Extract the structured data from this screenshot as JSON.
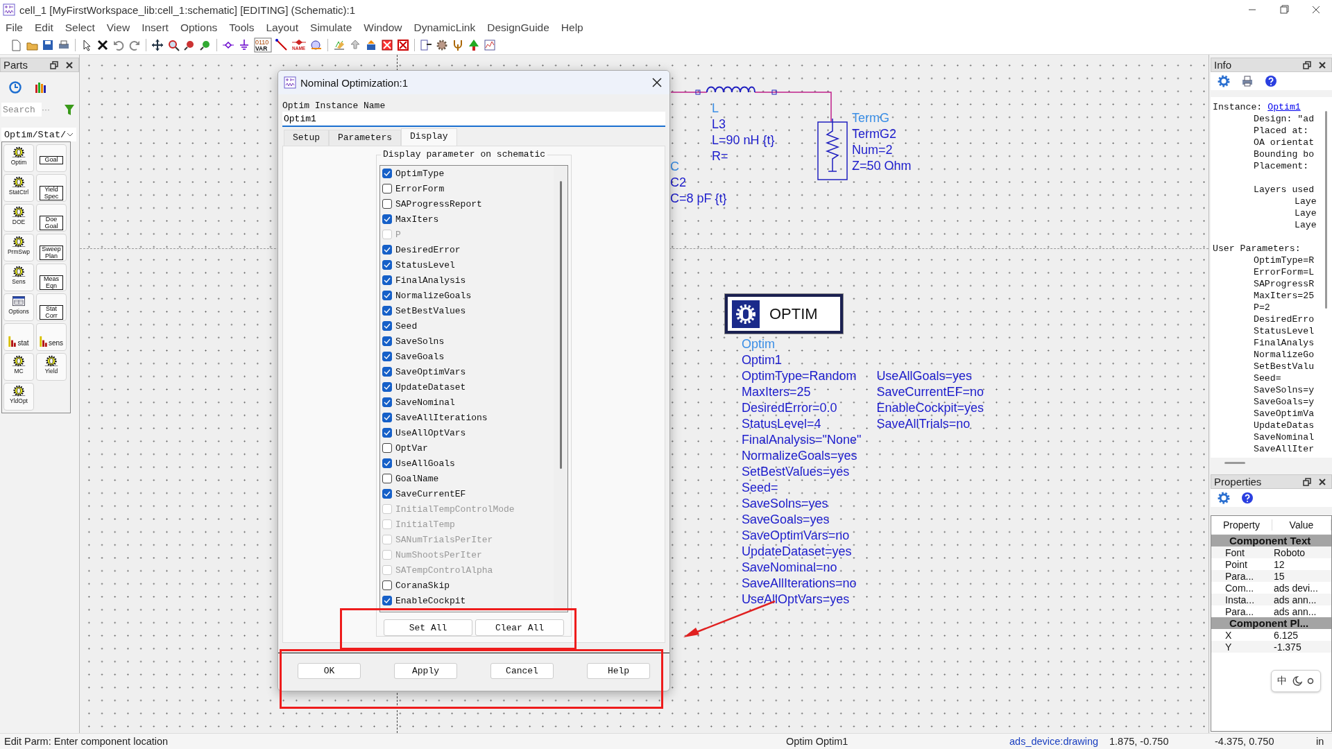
{
  "window": {
    "title": "cell_1 [MyFirstWorkspace_lib:cell_1:schematic] [EDITING] (Schematic):1"
  },
  "menu": [
    "File",
    "Edit",
    "Select",
    "View",
    "Insert",
    "Options",
    "Tools",
    "Layout",
    "Simulate",
    "Window",
    "DynamicLink",
    "DesignGuide",
    "Help"
  ],
  "toolbar": {
    "var_bits": "0110",
    "var_label": "VAR",
    "name_label": "NAME"
  },
  "parts_panel": {
    "title": "Parts",
    "search": {
      "placeholder": "Search",
      "more": "···"
    },
    "library": "Optim/Stat/",
    "items": [
      {
        "kind": "gear",
        "label": "Optim"
      },
      {
        "kind": "box",
        "label": "Goal"
      },
      {
        "kind": "gear",
        "label": "StatCtrl"
      },
      {
        "kind": "box",
        "label": "Yield Spec"
      },
      {
        "kind": "gear",
        "label": "DOE"
      },
      {
        "kind": "box",
        "label": "Doe Goal"
      },
      {
        "kind": "gear",
        "label": "PrmSwp"
      },
      {
        "kind": "box",
        "label": "Sweep Plan"
      },
      {
        "kind": "gear",
        "label": "Sens"
      },
      {
        "kind": "box",
        "label": "Meas Eqn"
      },
      {
        "kind": "window",
        "label": "Options"
      },
      {
        "kind": "box",
        "label": "Stat Corr"
      },
      {
        "kind": "chart",
        "label": "stat"
      },
      {
        "kind": "chart",
        "label": "sens"
      },
      {
        "kind": "gear",
        "label": "MC"
      },
      {
        "kind": "gear",
        "label": "Yield"
      },
      {
        "kind": "gear",
        "label": "YldOpt"
      }
    ]
  },
  "schematic": {
    "labels": [
      {
        "kind": "inductor",
        "lines": [
          "L",
          "L3",
          "L=90 nH {t}",
          "R="
        ]
      },
      {
        "kind": "capacitor",
        "lines": [
          "C",
          "C2",
          "C=8 pF {t}"
        ]
      },
      {
        "kind": "term",
        "lines": [
          "TermG",
          "TermG2",
          "Num=2",
          "Z=50 Ohm"
        ]
      }
    ],
    "optim_block": {
      "label": "OPTIM",
      "columns": [
        [
          "Optim",
          "Optim1",
          "OptimType=Random",
          "MaxIters=25",
          "DesiredError=0.0",
          "StatusLevel=4",
          "FinalAnalysis=\"None\"",
          "NormalizeGoals=yes",
          "SetBestValues=yes",
          "Seed=",
          "SaveSolns=yes",
          "SaveGoals=yes",
          "SaveOptimVars=no",
          "UpdateDataset=yes",
          "SaveNominal=no",
          "SaveAllIterations=no",
          "UseAllOptVars=yes"
        ],
        [
          "UseAllGoals=yes",
          "SaveCurrentEF=no",
          "EnableCockpit=yes",
          "SaveAllTrials=no"
        ]
      ]
    }
  },
  "dialog": {
    "title": "Nominal Optimization:1",
    "name_label": "Optim Instance Name",
    "name_value": "Optim1",
    "tabs": [
      {
        "label": "Setup",
        "selected": false
      },
      {
        "label": "Parameters",
        "selected": false
      },
      {
        "label": "Display",
        "selected": true
      }
    ],
    "group_title": "Display parameter on schematic",
    "items": [
      {
        "label": "OptimType",
        "checked": true,
        "disabled": false
      },
      {
        "label": "ErrorForm",
        "checked": false,
        "disabled": false
      },
      {
        "label": "SAProgressReport",
        "checked": false,
        "disabled": false
      },
      {
        "label": "MaxIters",
        "checked": true,
        "disabled": false
      },
      {
        "label": "P",
        "checked": false,
        "disabled": true
      },
      {
        "label": "DesiredError",
        "checked": true,
        "disabled": false
      },
      {
        "label": "StatusLevel",
        "checked": true,
        "disabled": false
      },
      {
        "label": "FinalAnalysis",
        "checked": true,
        "disabled": false
      },
      {
        "label": "NormalizeGoals",
        "checked": true,
        "disabled": false
      },
      {
        "label": "SetBestValues",
        "checked": true,
        "disabled": false
      },
      {
        "label": "Seed",
        "checked": true,
        "disabled": false
      },
      {
        "label": "SaveSolns",
        "checked": true,
        "disabled": false
      },
      {
        "label": "SaveGoals",
        "checked": true,
        "disabled": false
      },
      {
        "label": "SaveOptimVars",
        "checked": true,
        "disabled": false
      },
      {
        "label": "UpdateDataset",
        "checked": true,
        "disabled": false
      },
      {
        "label": "SaveNominal",
        "checked": true,
        "disabled": false
      },
      {
        "label": "SaveAllIterations",
        "checked": true,
        "disabled": false
      },
      {
        "label": "UseAllOptVars",
        "checked": true,
        "disabled": false
      },
      {
        "label": "OptVar",
        "checked": false,
        "disabled": false
      },
      {
        "label": "UseAllGoals",
        "checked": true,
        "disabled": false
      },
      {
        "label": "GoalName",
        "checked": false,
        "disabled": false
      },
      {
        "label": "SaveCurrentEF",
        "checked": true,
        "disabled": false
      },
      {
        "label": "InitialTempControlMode",
        "checked": false,
        "disabled": true
      },
      {
        "label": "InitialTemp",
        "checked": false,
        "disabled": true
      },
      {
        "label": "SANumTrialsPerIter",
        "checked": false,
        "disabled": true
      },
      {
        "label": "NumShootsPerIter",
        "checked": false,
        "disabled": true
      },
      {
        "label": "SATempControlAlpha",
        "checked": false,
        "disabled": true
      },
      {
        "label": "CoranaSkip",
        "checked": false,
        "disabled": false
      },
      {
        "label": "EnableCockpit",
        "checked": true,
        "disabled": false
      }
    ],
    "list_buttons": [
      "Set All",
      "Clear All"
    ],
    "buttons": [
      "OK",
      "Apply",
      "Cancel",
      "Help"
    ]
  },
  "info_panel": {
    "title": "Info",
    "sections": [
      {
        "label": "Instance:",
        "link": "Optim1",
        "children": [
          {
            "text": "Design: \"ad"
          },
          {
            "text": "Placed at:"
          },
          {
            "text": "OA orientat"
          },
          {
            "text": "Bounding bo"
          },
          {
            "text": "Placement:"
          },
          {
            "text": "Layers used",
            "children": [
              {
                "text": "Laye"
              },
              {
                "text": "Laye"
              },
              {
                "text": "Laye"
              }
            ]
          }
        ]
      },
      {
        "label": "User Parameters:",
        "children": [
          {
            "text": "OptimType=R"
          },
          {
            "text": "ErrorForm=L"
          },
          {
            "text": "SAProgressR"
          },
          {
            "text": "MaxIters=25"
          },
          {
            "text": "P=2"
          },
          {
            "text": "DesiredErro"
          },
          {
            "text": "StatusLevel"
          },
          {
            "text": "FinalAnalys"
          },
          {
            "text": "NormalizeGo"
          },
          {
            "text": "SetBestValu"
          },
          {
            "text": "Seed="
          },
          {
            "text": "SaveSolns=y"
          },
          {
            "text": "SaveGoals=y"
          },
          {
            "text": "SaveOptimVa"
          },
          {
            "text": "UpdateDatas"
          },
          {
            "text": "SaveNominal"
          },
          {
            "text": "SaveAllIter"
          }
        ]
      }
    ]
  },
  "properties_panel": {
    "title": "Properties",
    "columns": [
      "Property",
      "Value"
    ],
    "rows": [
      {
        "kind": "section",
        "property": "Component Text"
      },
      {
        "kind": "row",
        "property": "Font",
        "value": "Roboto"
      },
      {
        "kind": "row",
        "property": "Point",
        "value": "12"
      },
      {
        "kind": "row",
        "property": "Para...",
        "value": "15"
      },
      {
        "kind": "row",
        "property": "Com...",
        "value": "ads devi..."
      },
      {
        "kind": "row",
        "property": "Insta...",
        "value": "ads ann..."
      },
      {
        "kind": "row",
        "property": "Para...",
        "value": "ads ann..."
      },
      {
        "kind": "section",
        "property": "Component Pl..."
      },
      {
        "kind": "row",
        "property": "X",
        "value": "6.125"
      },
      {
        "kind": "row",
        "property": "Y",
        "value": "-1.375"
      }
    ],
    "ime": "中"
  },
  "status_bar": [
    {
      "kind": "plain",
      "text": "Edit Parm: Enter component location"
    },
    {
      "kind": "plain",
      "text": "Optim Optim1"
    },
    {
      "kind": "link",
      "text": "ads_device:drawing"
    },
    {
      "kind": "plain",
      "text": "1.875, -0.750"
    },
    {
      "kind": "plain",
      "text": "-4.375, 0.750"
    },
    {
      "kind": "plain",
      "text": "in"
    }
  ]
}
